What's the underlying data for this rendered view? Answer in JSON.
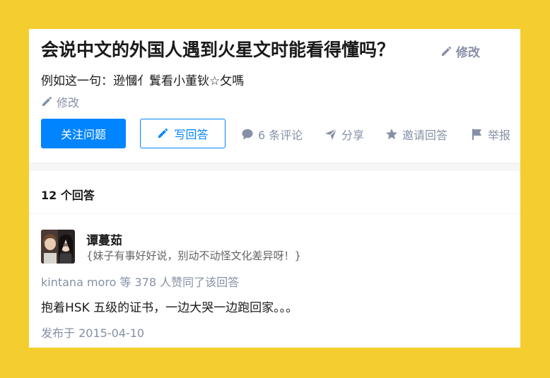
{
  "question": {
    "title": "会说中文的外国人遇到火星文时能看得懂吗？",
    "title_edit_label": "修改",
    "description": "例如这一句：逊慖亻鬒看小董钬☆攵嗎",
    "description_edit_label": "修改",
    "follow_button_label": "关注问题",
    "write_answer_label": "写回答",
    "comments_label": "6 条评论",
    "share_label": "分享",
    "invite_label": "邀请回答",
    "report_label": "举报"
  },
  "answers": {
    "count_label": "12 个回答",
    "items": [
      {
        "author_name": "谭蔓茹",
        "author_bio": "{妹子有事好好说，别动不动怪文化差异呀！}",
        "voters_text": "kintana moro 等 378 人赞同了该回答",
        "content": "抱着HSK 五级的证书，一边大哭一边跑回家。。。",
        "published": "发布于 2015-04-10"
      }
    ]
  },
  "colors": {
    "page_background": "#f4cd2f",
    "primary_blue": "#0084ff",
    "muted_text": "#8590a6",
    "title_text": "#1a1a1a"
  },
  "icons": [
    "pencil-icon",
    "comment-icon",
    "share-icon",
    "star-icon",
    "flag-icon"
  ]
}
